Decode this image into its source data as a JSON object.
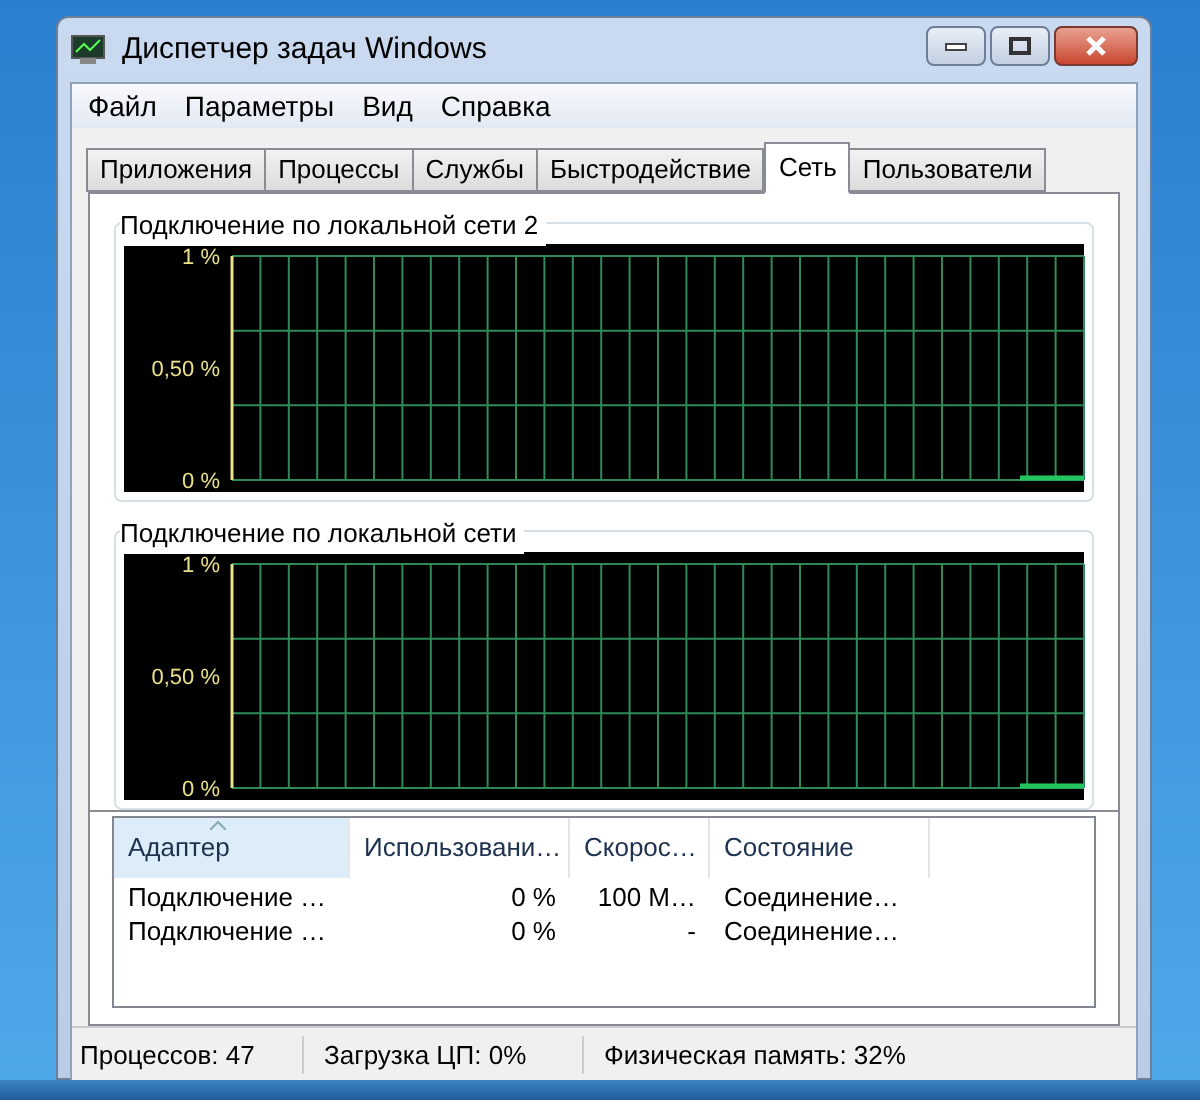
{
  "window": {
    "title": "Диспетчер задач Windows"
  },
  "menu": [
    "Файл",
    "Параметры",
    "Вид",
    "Справка"
  ],
  "tabs": [
    {
      "label": "Приложения",
      "selected": false
    },
    {
      "label": "Процессы",
      "selected": false
    },
    {
      "label": "Службы",
      "selected": false
    },
    {
      "label": "Быстродействие",
      "selected": false
    },
    {
      "label": "Сеть",
      "selected": true
    },
    {
      "label": "Пользователи",
      "selected": false
    }
  ],
  "graphs": [
    {
      "title": "Подключение по локальной сети 2",
      "y_labels": [
        "1 %",
        "0,50 %",
        "0 %"
      ]
    },
    {
      "title": "Подключение по локальной сети",
      "y_labels": [
        "1 %",
        "0,50 %",
        "0 %"
      ]
    }
  ],
  "table": {
    "columns": [
      {
        "label": "Адаптер",
        "sorted": true
      },
      {
        "label": "Использовани…",
        "sorted": false
      },
      {
        "label": "Скорос…",
        "sorted": false
      },
      {
        "label": "Состояние",
        "sorted": false
      }
    ],
    "rows": [
      [
        "Подключение …",
        "0 %",
        "100 М…",
        "Соединение…"
      ],
      [
        "Подключение …",
        "0 %",
        "-",
        "Соединение…"
      ]
    ]
  },
  "status_bar": [
    "Процессов: 47",
    "Загрузка ЦП: 0%",
    "Физическая память: 32%"
  ]
}
